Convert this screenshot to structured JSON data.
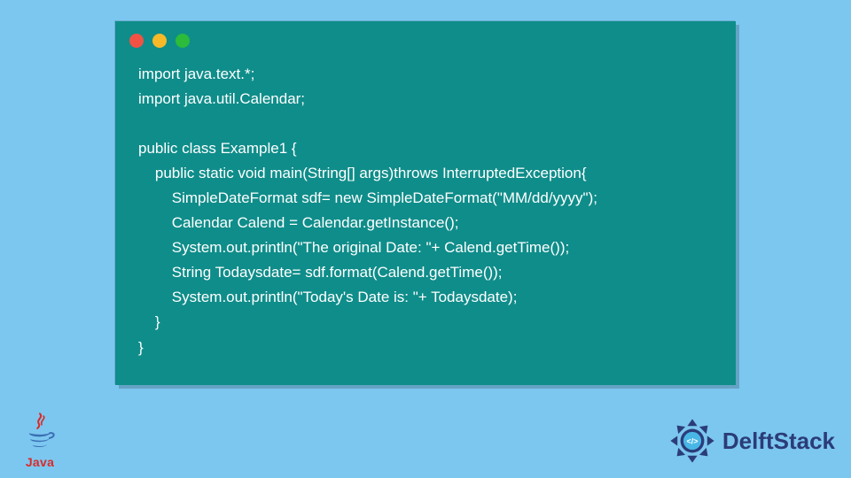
{
  "code": {
    "lines": [
      "import java.text.*;",
      "import java.util.Calendar;",
      "",
      "public class Example1 {",
      "    public static void main(String[] args)throws InterruptedException{",
      "        SimpleDateFormat sdf= new SimpleDateFormat(\"MM/dd/yyyy\");",
      "        Calendar Calend = Calendar.getInstance();",
      "        System.out.println(\"The original Date: \"+ Calend.getTime());",
      "        String Todaysdate= sdf.format(Calend.getTime());",
      "        System.out.println(\"Today's Date is: \"+ Todaysdate);",
      "    }",
      "}"
    ]
  },
  "window": {
    "dot_red": "#f25244",
    "dot_yellow": "#f7b928",
    "dot_green": "#2cbb3a",
    "bg": "#0f8d8a"
  },
  "logos": {
    "java_label": "Java",
    "delft_label": "DelftStack"
  }
}
